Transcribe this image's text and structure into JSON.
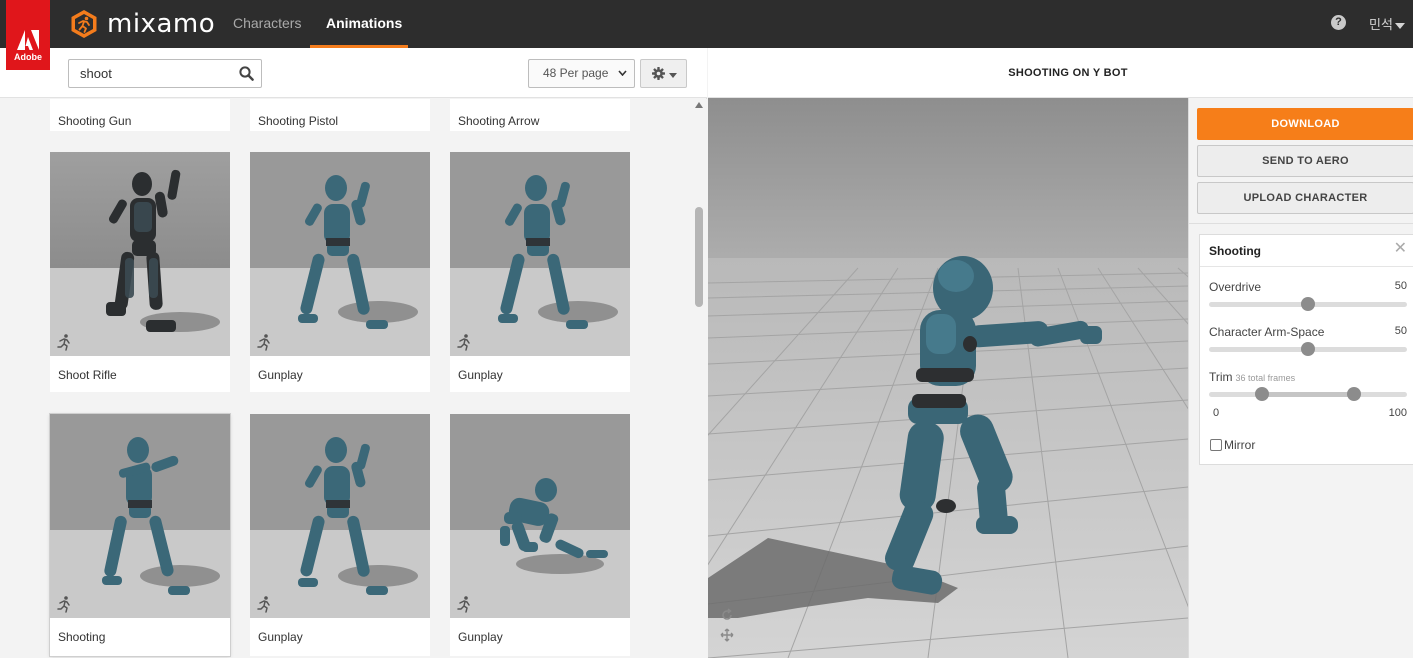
{
  "app": {
    "brand_word": "Adobe",
    "name": "mixamo",
    "nav": [
      {
        "label": "Characters",
        "active": false
      },
      {
        "label": "Animations",
        "active": true
      }
    ],
    "help_icon": "question-icon",
    "user_label": "민석",
    "accent_color": "#f47c1c"
  },
  "search": {
    "value": "shoot",
    "icon": "search-icon",
    "per_page": "48 Per page",
    "settings_icon": "gear-icon"
  },
  "results": [
    {
      "label": "Shooting Gun",
      "partial": true
    },
    {
      "label": "Shooting Pistol",
      "partial": true
    },
    {
      "label": "Shooting Arrow",
      "partial": true
    },
    {
      "label": "Shoot Rifle",
      "character": "soldier"
    },
    {
      "label": "Gunplay",
      "character": "y-bot"
    },
    {
      "label": "Gunplay",
      "character": "y-bot"
    },
    {
      "label": "Shooting",
      "character": "y-bot",
      "selected": true
    },
    {
      "label": "Gunplay",
      "character": "y-bot"
    },
    {
      "label": "Gunplay",
      "character": "y-bot",
      "pose": "crouch"
    }
  ],
  "viewer": {
    "title": "SHOOTING ON Y BOT",
    "tools": [
      "rotate-icon",
      "move-icon"
    ]
  },
  "actions": {
    "download": "DOWNLOAD",
    "send_to_aero": "SEND TO AERO",
    "upload_character": "UPLOAD CHARACTER",
    "download_color": "#f67e19"
  },
  "settings": {
    "title": "Shooting",
    "overdrive": {
      "label": "Overdrive",
      "value": "50",
      "level": 0.5
    },
    "arm_space": {
      "label": "Character Arm-Space",
      "value": "50",
      "level": 0.5
    },
    "trim": {
      "label": "Trim",
      "sub": "36 total frames",
      "min": "0",
      "max": "100",
      "start_level": 0.27,
      "end_level": 0.73
    },
    "mirror": {
      "label": "Mirror",
      "checked": false
    }
  }
}
